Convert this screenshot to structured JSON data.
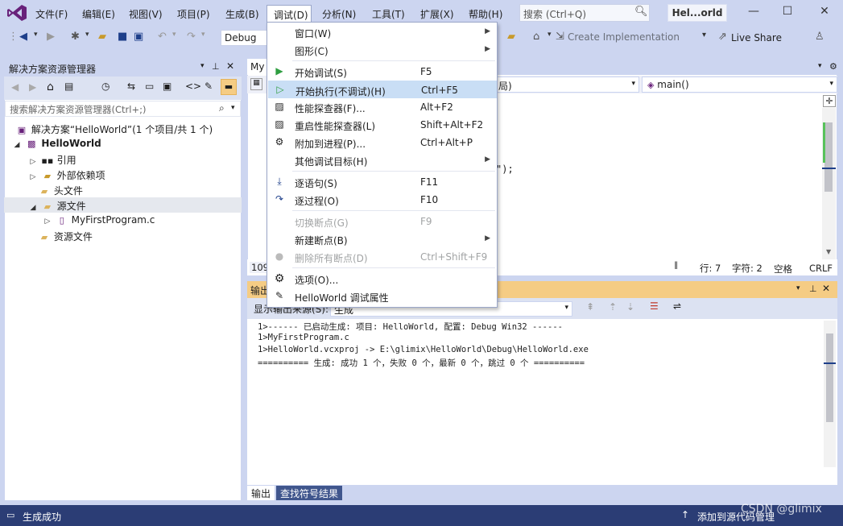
{
  "window": {
    "solution_name": "Hel...orld",
    "search_placeholder": "搜索 (Ctrl+Q)",
    "minimize": "—",
    "maximize": "☐",
    "close": "✕"
  },
  "menu": {
    "file": "文件(F)",
    "edit": "编辑(E)",
    "view": "视图(V)",
    "project": "项目(P)",
    "build": "生成(B)",
    "debug": "调试(D)",
    "analyze": "分析(N)",
    "tools": "工具(T)",
    "extensions": "扩展(X)",
    "help": "帮助(H)"
  },
  "toolbar": {
    "config": "Debug",
    "create_impl": "Create Implementation",
    "live_share": "Live Share"
  },
  "solution_explorer": {
    "title": "解决方案资源管理器",
    "search_placeholder": "搜索解决方案资源管理器(Ctrl+;)",
    "tree": [
      {
        "label": "解决方案“HelloWorld”(1 个项目/共 1 个)"
      },
      {
        "label": "HelloWorld"
      },
      {
        "label": "引用"
      },
      {
        "label": "外部依赖项"
      },
      {
        "label": "头文件"
      },
      {
        "label": "源文件"
      },
      {
        "label": "MyFirstProgram.c"
      },
      {
        "label": "资源文件"
      }
    ]
  },
  "editor": {
    "tab_label": "My",
    "nav_mid": "局)",
    "nav_function": "main()",
    "code_fragment": "\");",
    "zoom": "109",
    "status": {
      "line": "行: 7",
      "char": "字符: 2",
      "mode": "空格",
      "eol": "CRLF"
    }
  },
  "debug_menu": {
    "items": [
      {
        "label": "窗口(W)",
        "shortcut": ""
      },
      {
        "label": "图形(C)",
        "shortcut": ""
      },
      {
        "label": "开始调试(S)",
        "shortcut": "F5"
      },
      {
        "label": "开始执行(不调试)(H)",
        "shortcut": "Ctrl+F5"
      },
      {
        "label": "性能探查器(F)...",
        "shortcut": "Alt+F2"
      },
      {
        "label": "重启性能探查器(L)",
        "shortcut": "Shift+Alt+F2"
      },
      {
        "label": "附加到进程(P)...",
        "shortcut": "Ctrl+Alt+P"
      },
      {
        "label": "其他调试目标(H)",
        "shortcut": ""
      },
      {
        "label": "逐语句(S)",
        "shortcut": "F11"
      },
      {
        "label": "逐过程(O)",
        "shortcut": "F10"
      },
      {
        "label": "切换断点(G)",
        "shortcut": "F9"
      },
      {
        "label": "新建断点(B)",
        "shortcut": ""
      },
      {
        "label": "删除所有断点(D)",
        "shortcut": "Ctrl+Shift+F9"
      },
      {
        "label": "选项(O)...",
        "shortcut": ""
      },
      {
        "label": "HelloWorld 调试属性",
        "shortcut": ""
      }
    ]
  },
  "output": {
    "title": "输出",
    "source_label": "显示输出来源(S):",
    "source_value": "生成",
    "lines": [
      "1>------ 已启动生成: 项目: HelloWorld, 配置: Debug Win32 ------",
      "1>MyFirstProgram.c",
      "1>HelloWorld.vcxproj -> E:\\glimix\\HelloWorld\\Debug\\HelloWorld.exe",
      "========== 生成: 成功 1 个，失败 0 个，最新 0 个，跳过 0 个 =========="
    ],
    "tabs": [
      "输出",
      "查找符号结果"
    ]
  },
  "status_bar": {
    "message": "生成成功",
    "source_control": "添加到源代码管理",
    "watermark": "CSDN @glimix"
  },
  "colors": {
    "chrome": "#ccd5f0",
    "status_bar": "#2b3d75",
    "output_header": "#f5cc84",
    "menu_highlight": "#c9def5",
    "vs_purple": "#68217a"
  }
}
